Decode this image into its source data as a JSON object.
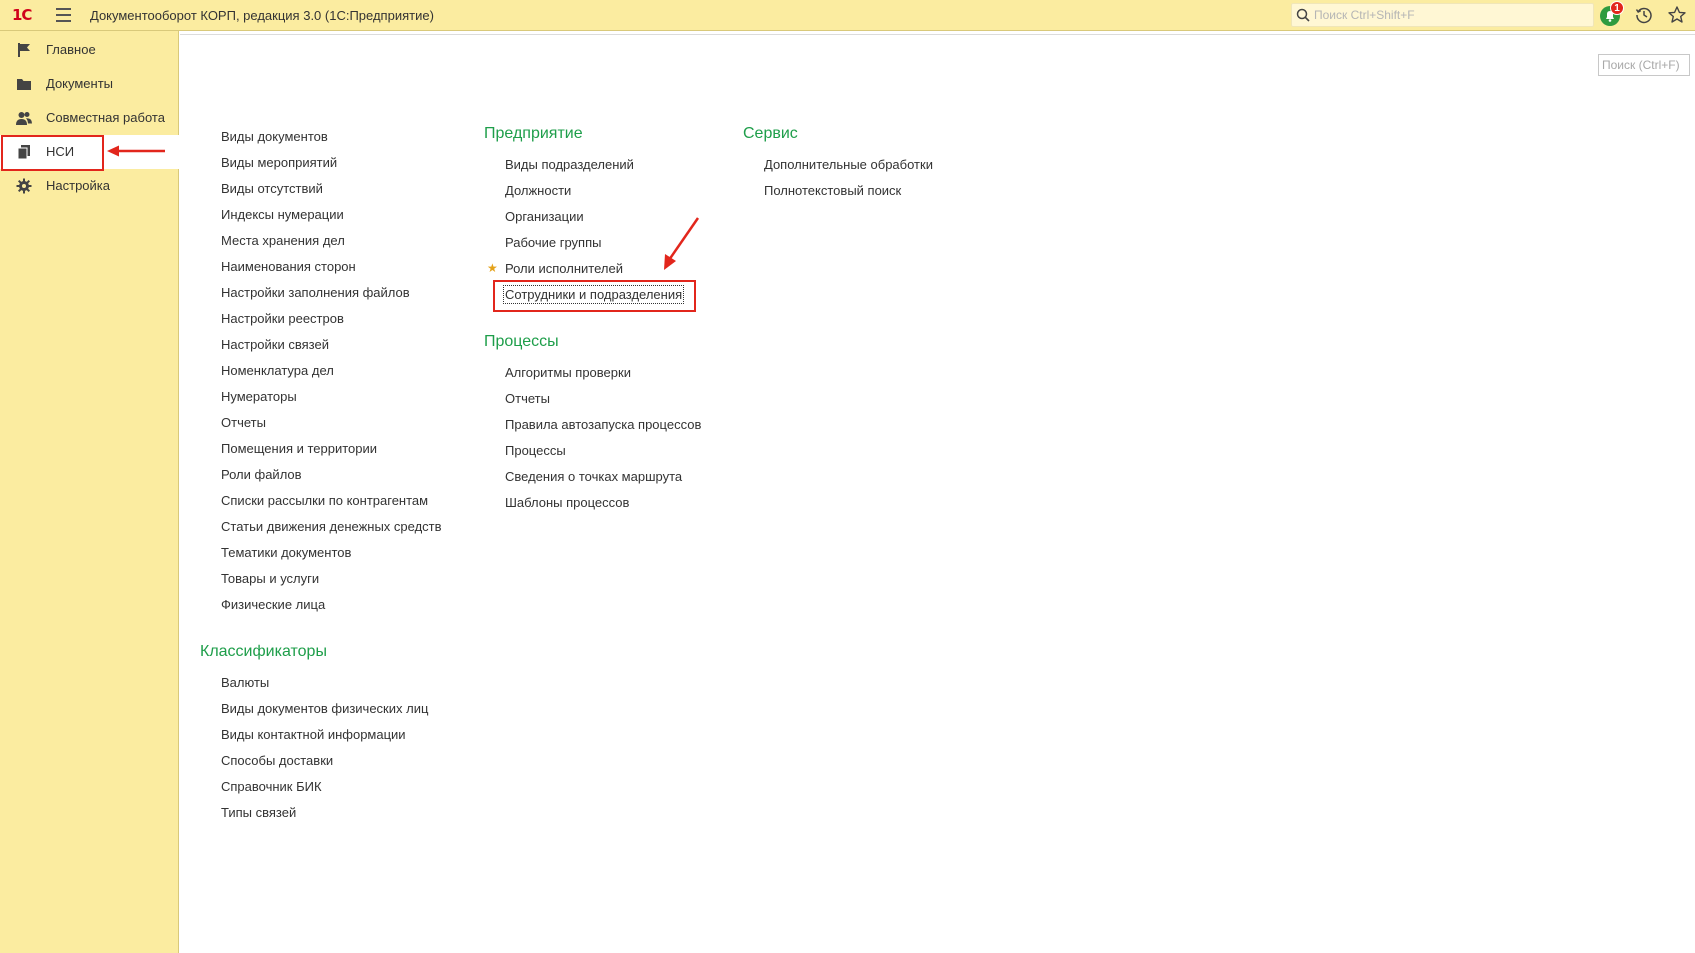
{
  "app": {
    "logo_text": "1С",
    "title": "Документооборот КОРП, редакция 3.0  (1С:Предприятие)",
    "search_placeholder": "Поиск Ctrl+Shift+F",
    "notification_count": "1"
  },
  "sidebar": {
    "items": [
      {
        "label": "Главное",
        "icon": "flag-icon"
      },
      {
        "label": "Документы",
        "icon": "folder-icon"
      },
      {
        "label": "Совместная работа",
        "icon": "users-icon"
      },
      {
        "label": "НСИ",
        "icon": "reference-book-icon",
        "active": true
      },
      {
        "label": "Настройка",
        "icon": "gear-icon"
      }
    ]
  },
  "main": {
    "search_placeholder": "Поиск (Ctrl+F)",
    "general_links": [
      "Виды документов",
      "Виды мероприятий",
      "Виды отсутствий",
      "Индексы нумерации",
      "Места хранения дел",
      "Наименования сторон",
      "Настройки заполнения файлов",
      "Настройки реестров",
      "Настройки связей",
      "Номенклатура дел",
      "Нумераторы",
      "Отчеты",
      "Помещения и территории",
      "Роли файлов",
      "Списки рассылки по контрагентам",
      "Статьи движения денежных средств",
      "Тематики документов",
      "Товары и услуги",
      "Физические лица"
    ],
    "classifiers": {
      "title": "Классификаторы",
      "links": [
        "Валюты",
        "Виды документов физических лиц",
        "Виды контактной информации",
        "Способы доставки",
        "Справочник БИК",
        "Типы связей"
      ]
    },
    "enterprise": {
      "title": "Предприятие",
      "links": [
        "Виды подразделений",
        "Должности",
        "Организации",
        "Рабочие группы",
        "Роли исполнителей",
        "Сотрудники и подразделения"
      ]
    },
    "processes": {
      "title": "Процессы",
      "links": [
        "Алгоритмы проверки",
        "Отчеты",
        "Правила автозапуска процессов",
        "Процессы",
        "Сведения о точках маршрута",
        "Шаблоны процессов"
      ]
    },
    "service": {
      "title": "Сервис",
      "links": [
        "Дополнительные обработки",
        "Полнотекстовый поиск"
      ]
    }
  },
  "colors": {
    "panel": "#fbeca0",
    "section_title": "#1e9e4a",
    "highlight": "#e2261c",
    "star": "#e4a21a"
  }
}
